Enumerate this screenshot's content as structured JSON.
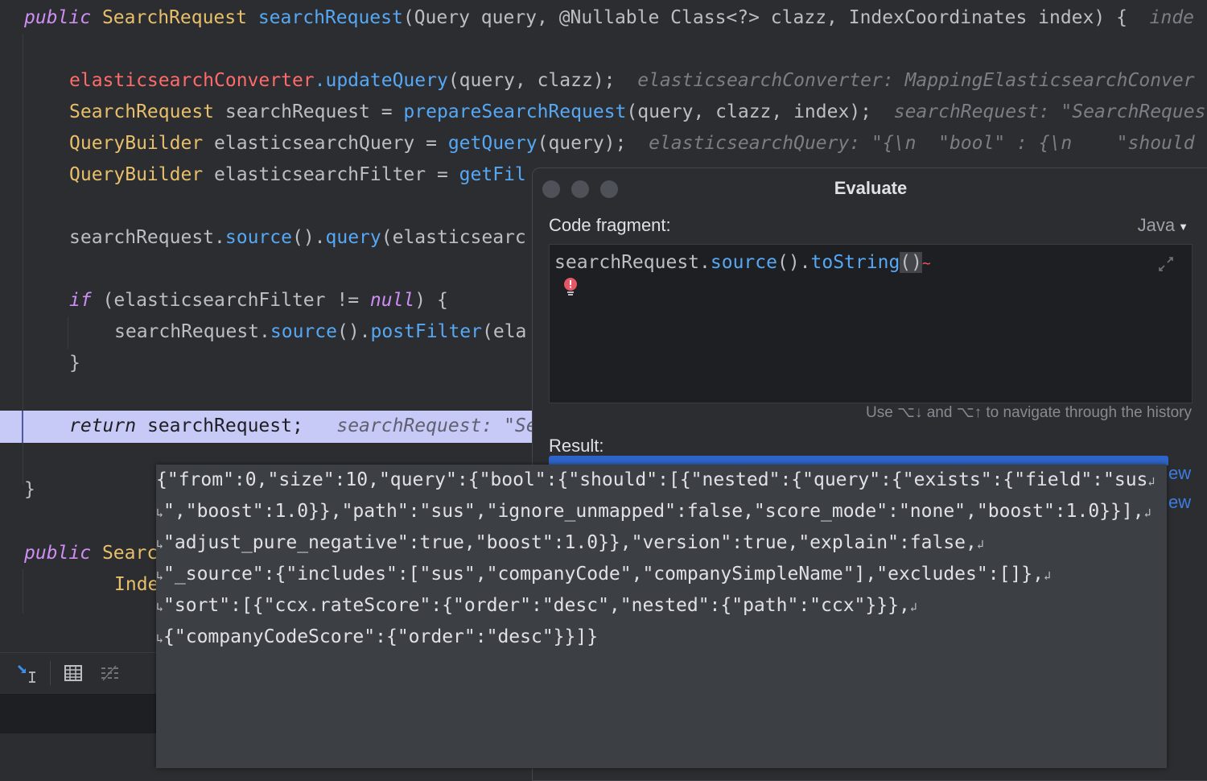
{
  "editor": {
    "line1": {
      "kw": "public",
      "type": "SearchRequest",
      "method": "searchRequest",
      "params": "(Query query, @Nullable Class<?> clazz, IndexCoordinates index) {",
      "hint": "inde"
    },
    "line2": {
      "field": "elasticsearchConverter",
      "method": ".updateQuery",
      "args": "(query, clazz);",
      "hint": "elasticsearchConverter: MappingElasticsearchConver"
    },
    "line3": {
      "type": "SearchRequest",
      "plain": " searchRequest = ",
      "method": "prepareSearchRequest",
      "args": "(query, clazz, index);",
      "hint": "searchRequest: \"SearchReques"
    },
    "line4": {
      "type": "QueryBuilder",
      "plain": " elasticsearchQuery = ",
      "method": "getQuery",
      "args": "(query);",
      "hint": "elasticsearchQuery: \"{\\n  \"bool\" : {\\n    \"should"
    },
    "line5": {
      "type": "QueryBuilder",
      "plain": " elasticsearchFilter = ",
      "method": "getFil"
    },
    "line6": {
      "plain1": "searchRequest.",
      "method1": "source",
      "plain2": "().",
      "method2": "query",
      "plain3": "(elasticsearc"
    },
    "line7": {
      "kw": "if",
      "plain": " (elasticsearchFilter != ",
      "kw2": "null",
      "plain2": ") {"
    },
    "line8": {
      "plain1": "searchRequest.",
      "method1": "source",
      "plain2": "().",
      "method2": "postFilter",
      "plain3": "(ela"
    },
    "line9": {
      "plain": "}"
    },
    "line10": {
      "kw": "return",
      "plain": " searchRequest;",
      "hint": "searchRequest: \"Se"
    },
    "line11": {
      "plain": "}"
    },
    "line12": {
      "kw": "public",
      "type": "Searc"
    },
    "line13": {
      "type": "Inde"
    }
  },
  "evaluate": {
    "title": "Evaluate",
    "code_fragment_label": "Code fragment:",
    "language": "Java",
    "code": {
      "plain1": "searchRequest.",
      "method1": "source",
      "plain2": "().",
      "method2": "toString",
      "caret_text": "()"
    },
    "history_hint": "Use ⌥↓ and ⌥↑ to navigate through the history",
    "result_label": "Result:",
    "side_link_1": "ew",
    "side_link_2": "ew"
  },
  "result_popup": {
    "lines": [
      "{\"from\":0,\"size\":10,\"query\":{\"bool\":{\"should\":[{\"nested\":{\"query\":{\"exists\":{\"field\":\"sus",
      "\",\"boost\":1.0}},\"path\":\"sus\",\"ignore_unmapped\":false,\"score_mode\":\"none\",\"boost\":1.0}}],",
      "\"adjust_pure_negative\":true,\"boost\":1.0}},\"version\":true,\"explain\":false,",
      "\"_source\":{\"includes\":[\"sus\",\"companyCode\",\"companySimpleName\"],\"excludes\":[]},",
      "\"sort\":[{\"ccx.rateScore\":{\"order\":\"desc\",\"nested\":{\"path\":\"ccx\"}}},",
      "{\"companyCodeScore\":{\"order\":\"desc\"}}]}"
    ]
  },
  "icons": [
    "step-into-icon",
    "table-icon",
    "format-icon",
    "error-bulb-icon",
    "expand-icon",
    "wrap-arrow-icon"
  ]
}
